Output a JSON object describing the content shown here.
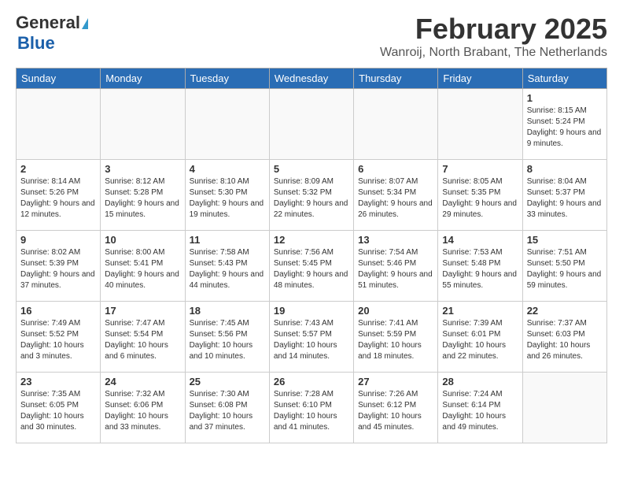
{
  "header": {
    "logo_general": "General",
    "logo_blue": "Blue",
    "month_title": "February 2025",
    "location": "Wanroij, North Brabant, The Netherlands"
  },
  "weekdays": [
    "Sunday",
    "Monday",
    "Tuesday",
    "Wednesday",
    "Thursday",
    "Friday",
    "Saturday"
  ],
  "weeks": [
    [
      {
        "day": "",
        "info": ""
      },
      {
        "day": "",
        "info": ""
      },
      {
        "day": "",
        "info": ""
      },
      {
        "day": "",
        "info": ""
      },
      {
        "day": "",
        "info": ""
      },
      {
        "day": "",
        "info": ""
      },
      {
        "day": "1",
        "info": "Sunrise: 8:15 AM\nSunset: 5:24 PM\nDaylight: 9 hours and 9 minutes."
      }
    ],
    [
      {
        "day": "2",
        "info": "Sunrise: 8:14 AM\nSunset: 5:26 PM\nDaylight: 9 hours and 12 minutes."
      },
      {
        "day": "3",
        "info": "Sunrise: 8:12 AM\nSunset: 5:28 PM\nDaylight: 9 hours and 15 minutes."
      },
      {
        "day": "4",
        "info": "Sunrise: 8:10 AM\nSunset: 5:30 PM\nDaylight: 9 hours and 19 minutes."
      },
      {
        "day": "5",
        "info": "Sunrise: 8:09 AM\nSunset: 5:32 PM\nDaylight: 9 hours and 22 minutes."
      },
      {
        "day": "6",
        "info": "Sunrise: 8:07 AM\nSunset: 5:34 PM\nDaylight: 9 hours and 26 minutes."
      },
      {
        "day": "7",
        "info": "Sunrise: 8:05 AM\nSunset: 5:35 PM\nDaylight: 9 hours and 29 minutes."
      },
      {
        "day": "8",
        "info": "Sunrise: 8:04 AM\nSunset: 5:37 PM\nDaylight: 9 hours and 33 minutes."
      }
    ],
    [
      {
        "day": "9",
        "info": "Sunrise: 8:02 AM\nSunset: 5:39 PM\nDaylight: 9 hours and 37 minutes."
      },
      {
        "day": "10",
        "info": "Sunrise: 8:00 AM\nSunset: 5:41 PM\nDaylight: 9 hours and 40 minutes."
      },
      {
        "day": "11",
        "info": "Sunrise: 7:58 AM\nSunset: 5:43 PM\nDaylight: 9 hours and 44 minutes."
      },
      {
        "day": "12",
        "info": "Sunrise: 7:56 AM\nSunset: 5:45 PM\nDaylight: 9 hours and 48 minutes."
      },
      {
        "day": "13",
        "info": "Sunrise: 7:54 AM\nSunset: 5:46 PM\nDaylight: 9 hours and 51 minutes."
      },
      {
        "day": "14",
        "info": "Sunrise: 7:53 AM\nSunset: 5:48 PM\nDaylight: 9 hours and 55 minutes."
      },
      {
        "day": "15",
        "info": "Sunrise: 7:51 AM\nSunset: 5:50 PM\nDaylight: 9 hours and 59 minutes."
      }
    ],
    [
      {
        "day": "16",
        "info": "Sunrise: 7:49 AM\nSunset: 5:52 PM\nDaylight: 10 hours and 3 minutes."
      },
      {
        "day": "17",
        "info": "Sunrise: 7:47 AM\nSunset: 5:54 PM\nDaylight: 10 hours and 6 minutes."
      },
      {
        "day": "18",
        "info": "Sunrise: 7:45 AM\nSunset: 5:56 PM\nDaylight: 10 hours and 10 minutes."
      },
      {
        "day": "19",
        "info": "Sunrise: 7:43 AM\nSunset: 5:57 PM\nDaylight: 10 hours and 14 minutes."
      },
      {
        "day": "20",
        "info": "Sunrise: 7:41 AM\nSunset: 5:59 PM\nDaylight: 10 hours and 18 minutes."
      },
      {
        "day": "21",
        "info": "Sunrise: 7:39 AM\nSunset: 6:01 PM\nDaylight: 10 hours and 22 minutes."
      },
      {
        "day": "22",
        "info": "Sunrise: 7:37 AM\nSunset: 6:03 PM\nDaylight: 10 hours and 26 minutes."
      }
    ],
    [
      {
        "day": "23",
        "info": "Sunrise: 7:35 AM\nSunset: 6:05 PM\nDaylight: 10 hours and 30 minutes."
      },
      {
        "day": "24",
        "info": "Sunrise: 7:32 AM\nSunset: 6:06 PM\nDaylight: 10 hours and 33 minutes."
      },
      {
        "day": "25",
        "info": "Sunrise: 7:30 AM\nSunset: 6:08 PM\nDaylight: 10 hours and 37 minutes."
      },
      {
        "day": "26",
        "info": "Sunrise: 7:28 AM\nSunset: 6:10 PM\nDaylight: 10 hours and 41 minutes."
      },
      {
        "day": "27",
        "info": "Sunrise: 7:26 AM\nSunset: 6:12 PM\nDaylight: 10 hours and 45 minutes."
      },
      {
        "day": "28",
        "info": "Sunrise: 7:24 AM\nSunset: 6:14 PM\nDaylight: 10 hours and 49 minutes."
      },
      {
        "day": "",
        "info": ""
      }
    ]
  ]
}
